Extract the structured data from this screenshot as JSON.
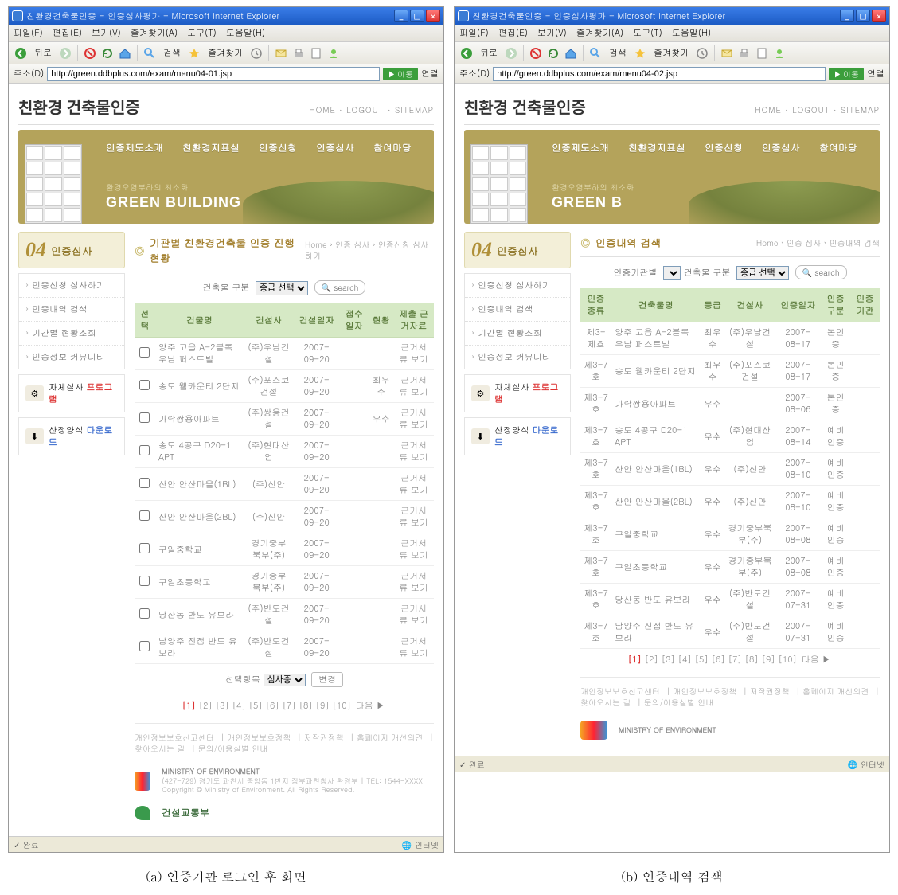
{
  "left": {
    "window_title": "친환경건축물인증 - 인증심사평가 - Microsoft Internet Explorer",
    "menubar": [
      "파일(F)",
      "편집(E)",
      "보기(V)",
      "즐겨찾기(A)",
      "도구(T)",
      "도움말(H)"
    ],
    "toolbar": {
      "back": "뒤로",
      "search": "검색",
      "favorites": "즐겨찾기"
    },
    "addr_label": "주소(D)",
    "url": "http://green.ddbplus.com/exam/menu04-01.jsp",
    "go": "이동",
    "links": "연결",
    "site_title": "친환경 건축물인증",
    "site_links": "HOME ·  LOGOUT ·  SITEMAP",
    "hero_nav": [
      "인증제도소개",
      "친환경지표실",
      "인증신청",
      "인증심사",
      "참여마당"
    ],
    "hero_sub": "환경오염부하의 최소화",
    "hero_big": "GREEN BUILDING",
    "side": {
      "num": "04",
      "label": "인증심사",
      "items": [
        "인증신청 심사하기",
        "인증내역 검색",
        "기간별 현황조회",
        "인증정보 커뮤니티"
      ],
      "badge1_pre": "자체실사",
      "badge1_em": "프로그램",
      "badge2_pre": "산정양식",
      "badge2_em": "다운로드"
    },
    "section_title": "기관별 친환경건축물 인증 진행 현황",
    "crumb": "Home › 인증 심사 › 인증신청 심사하기",
    "filter": {
      "label1": "건축물 구분",
      "sel1": "종급 선택",
      "btn": "search"
    },
    "table": {
      "headers": [
        "선택",
        "건물명",
        "건설사",
        "건설일자",
        "접수일자",
        "현황",
        "제출 근거자료"
      ],
      "rows": [
        {
          "name": "양주 고읍 A-2블록 우남 퍼스트빌",
          "builder": "(주)우남건설",
          "date": "2007-09-20",
          "recv": "",
          "status": "",
          "evi": "근거서류 보기"
        },
        {
          "name": "송도 웰카운티 2단지",
          "builder": "(주)포스코건설",
          "date": "2007-09-20",
          "recv": "",
          "status": "최우수",
          "evi": "근거서류 보기"
        },
        {
          "name": "가락쌍용아파트",
          "builder": "(주)쌍용건설",
          "date": "2007-09-20",
          "recv": "",
          "status": "우수",
          "evi": "근거서류 보기"
        },
        {
          "name": "송도 4공구 D20-1 APT",
          "builder": "(주)현대산업",
          "date": "2007-09-20",
          "recv": "",
          "status": "",
          "evi": "근거서류 보기"
        },
        {
          "name": "산안 안산마을(1BL)",
          "builder": "(주)신안",
          "date": "2007-09-20",
          "recv": "",
          "status": "",
          "evi": "근거서류 보기"
        },
        {
          "name": "산안 안산마을(2BL)",
          "builder": "(주)신안",
          "date": "2007-09-20",
          "recv": "",
          "status": "",
          "evi": "근거서류 보기"
        },
        {
          "name": "구일중학교",
          "builder": "경기중부북부(주)",
          "date": "2007-09-20",
          "recv": "",
          "status": "",
          "evi": "근거서류 보기"
        },
        {
          "name": "구일초등학교",
          "builder": "경기중부북부(주)",
          "date": "2007-09-20",
          "recv": "",
          "status": "",
          "evi": "근거서류 보기"
        },
        {
          "name": "당산동 반도 유보라",
          "builder": "(주)반도건설",
          "date": "2007-09-20",
          "recv": "",
          "status": "",
          "evi": "근거서류 보기"
        },
        {
          "name": "남양주 진접 반도 유보라",
          "builder": "(주)반도건설",
          "date": "2007-09-20",
          "recv": "",
          "status": "",
          "evi": "근거서류 보기"
        }
      ]
    },
    "action": {
      "label": "선택항목",
      "sel": "심사중",
      "ok": "변경"
    },
    "pager_current": "[1]",
    "pager_pages": "[2] [3] [4] [5] [6] [7] [8] [9] [10]",
    "pager_next": "다음 ▶",
    "foot_links": [
      "개인정보보호신고센터",
      "개인정보보호정책",
      "저작권정책",
      "홈페이지 개선의견",
      "찾아오시는 길",
      "문의/이용실별 안내"
    ],
    "footer1": "MINISTRY OF ENVIRONMENT",
    "footer2": "건설교통부",
    "footer_addr": "(427-729) 경기도 과천시 중앙동 1번지 정부과천청사 환경부 | TEL: 1544-XXXX\nCopyright © Ministry of Environment. All Rights Reserved.",
    "status_done": "완료",
    "status_zone": "인터넷",
    "caption": "(a) 인증기관 로그인 후 화면"
  },
  "right": {
    "window_title": "친환경건축물인증 - 인증심사평가 - Microsoft Internet Explorer",
    "url": "http://green.ddbplus.com/exam/menu04-02.jsp",
    "hero_big": "GREEN B",
    "section_title": "인증내역 검색",
    "crumb": "Home › 인증 심사 › 인증내역 검색",
    "filter": {
      "label0": "인증기관별",
      "label1": "건축물 구분",
      "sel1": "종급 선택",
      "btn": "search"
    },
    "table": {
      "headers": [
        "인증종류",
        "건축물명",
        "등급",
        "건설사",
        "인증일자",
        "인증구분",
        "인증기관"
      ],
      "rows": [
        {
          "cert": "제3-제호",
          "name": "양주 고읍 A-2블록 우남 퍼스트빌",
          "grade": "최우수",
          "builder": "(주)우남건설",
          "date": "2007-08-17",
          "type": "본인증",
          "org": ""
        },
        {
          "cert": "제3-7호",
          "name": "송도 웰카운티 2단지",
          "grade": "최우수",
          "builder": "(주)포스코건설",
          "date": "2007-08-17",
          "type": "본인증",
          "org": ""
        },
        {
          "cert": "제3-7호",
          "name": "가락쌍용아파트",
          "grade": "우수",
          "builder": "",
          "date": "2007-08-06",
          "type": "본인증",
          "org": ""
        },
        {
          "cert": "제3-7호",
          "name": "송도 4공구 D20-1 APT",
          "grade": "우수",
          "builder": "(주)현대산업",
          "date": "2007-08-14",
          "type": "예비인증",
          "org": ""
        },
        {
          "cert": "제3-7호",
          "name": "산안 안산마을(1BL)",
          "grade": "우수",
          "builder": "(주)신안",
          "date": "2007-08-10",
          "type": "예비인증",
          "org": ""
        },
        {
          "cert": "제3-7호",
          "name": "산안 안산마을(2BL)",
          "grade": "우수",
          "builder": "(주)신안",
          "date": "2007-08-10",
          "type": "예비인증",
          "org": ""
        },
        {
          "cert": "제3-7호",
          "name": "구일중학교",
          "grade": "우수",
          "builder": "경기중부북부(주)",
          "date": "2007-08-08",
          "type": "예비인증",
          "org": ""
        },
        {
          "cert": "제3-7호",
          "name": "구일초등학교",
          "grade": "우수",
          "builder": "경기중부북부(주)",
          "date": "2007-08-08",
          "type": "예비인증",
          "org": ""
        },
        {
          "cert": "제3-7호",
          "name": "당산동 반도 유보라",
          "grade": "우수",
          "builder": "(주)반도건설",
          "date": "2007-07-31",
          "type": "예비인증",
          "org": ""
        },
        {
          "cert": "제3-7호",
          "name": "남양주 진접 반도 유보라",
          "grade": "우수",
          "builder": "(주)반도건설",
          "date": "2007-07-31",
          "type": "예비인증",
          "org": ""
        }
      ]
    },
    "caption": "(b) 인증내역 검색"
  }
}
